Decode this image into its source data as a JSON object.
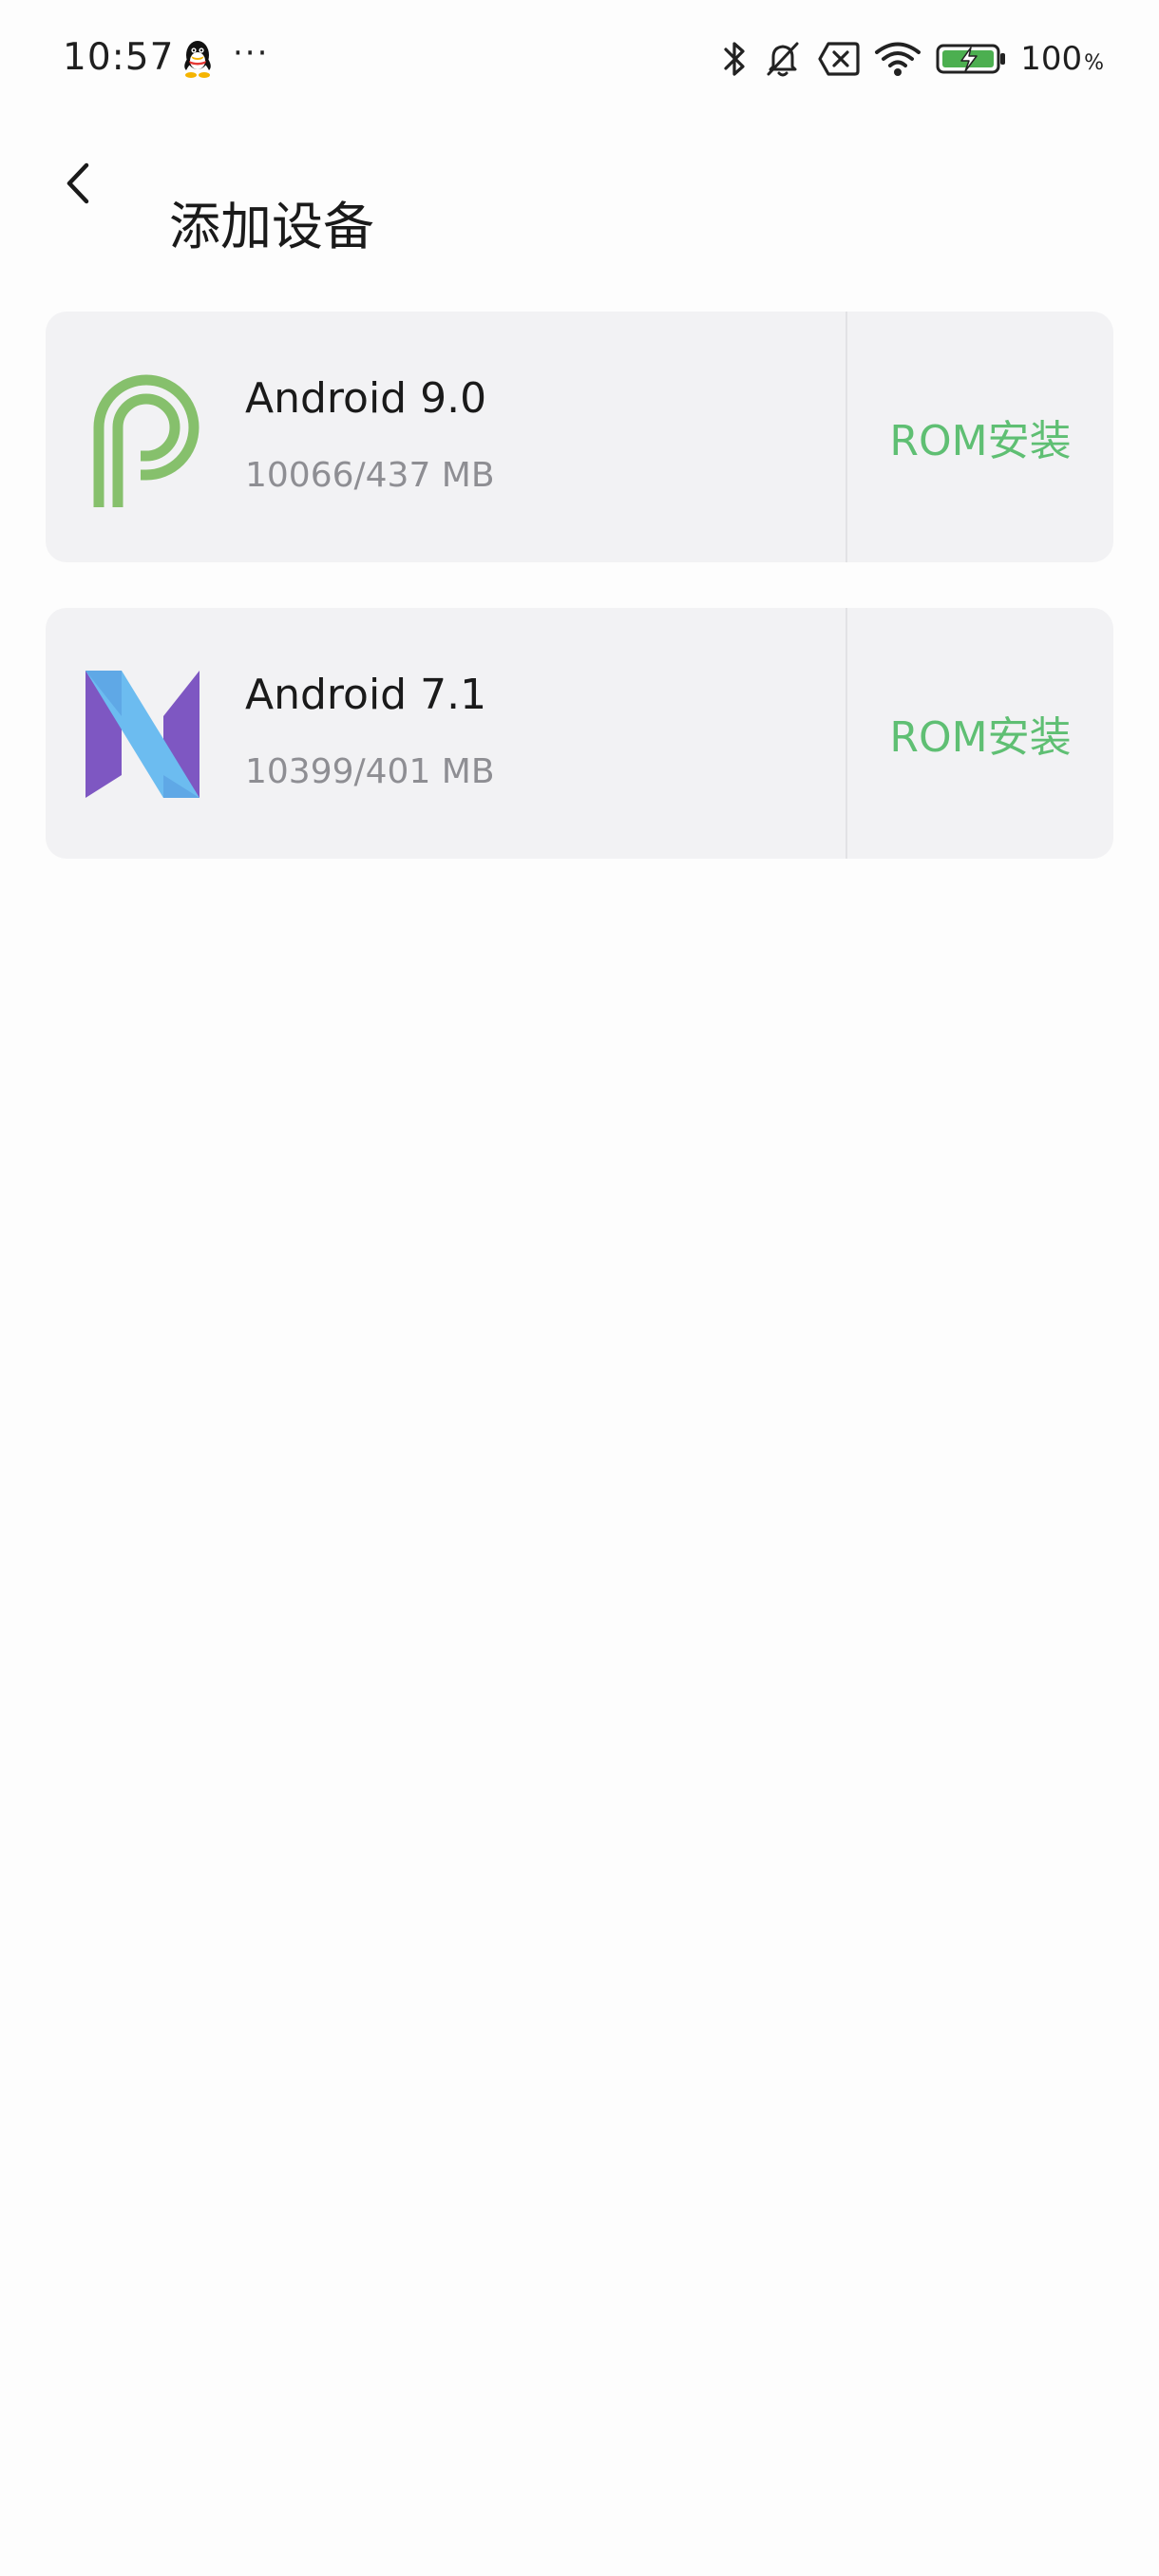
{
  "status_bar": {
    "time": "10:57",
    "dots": "···",
    "battery_percent": "100",
    "battery_unit": "%",
    "icons": [
      "qq-icon",
      "bluetooth-icon",
      "mute-icon",
      "sim-off-icon",
      "wifi-icon",
      "battery-charging-icon"
    ]
  },
  "header": {
    "title": "添加设备",
    "back_icon": "back-arrow-icon"
  },
  "devices": [
    {
      "name": "Android 9.0",
      "size": "10066/437 MB",
      "action": "ROM安装",
      "logo": "android-p-logo"
    },
    {
      "name": "Android 7.1",
      "size": "10399/401 MB",
      "action": "ROM安装",
      "logo": "android-n-logo"
    }
  ],
  "colors": {
    "accent": "#5fbf73",
    "card_bg": "#f2f2f4",
    "secondary_text": "#8e8e93",
    "android_p_green": "#86c06c",
    "android_n_purple": "#7e57c2",
    "android_n_blue": "#64b5f6"
  }
}
